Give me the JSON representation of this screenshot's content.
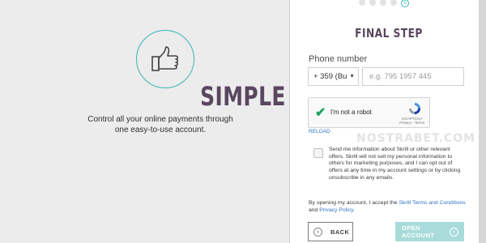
{
  "hero": {
    "icon": "thumbs-up-icon",
    "title": "SIMPLE",
    "description": "Control all your online payments through one easy-to-use account."
  },
  "progress": {
    "total_steps": 5,
    "current_step": 5,
    "current_marker": "5"
  },
  "form": {
    "title": "FINAL STEP",
    "phone_label": "Phone number",
    "country_code_value": "+ 359 (Bu",
    "phone_placeholder": "e.g. 795 1957 445",
    "captcha_label": "I'm not a robot",
    "captcha_brand": "reCAPTCHA",
    "captcha_links": "Privacy - Terms",
    "reload_label": "RELOAD",
    "watermark": "NOSTRABET.COM",
    "consent_text": "Send me information about Skrill or other relevant offers. Skrill will not sell my personal information to others for marketing purposes, and I can opt out of offers at any time in my account settings or by clicking unsubscribe in any emails.",
    "terms_prefix": "By opening my account, I accept the ",
    "terms_link": "Skrill Terms and Conditions",
    "terms_mid": " and ",
    "privacy_link": "Privacy Policy",
    "terms_suffix": ".",
    "back_label": "BACK",
    "open_label": "OPEN ACCOUNT"
  },
  "colors": {
    "accent": "#39b4b4",
    "title": "#5a4660",
    "link": "#2d74c4",
    "open_button": "#a8dcda"
  }
}
